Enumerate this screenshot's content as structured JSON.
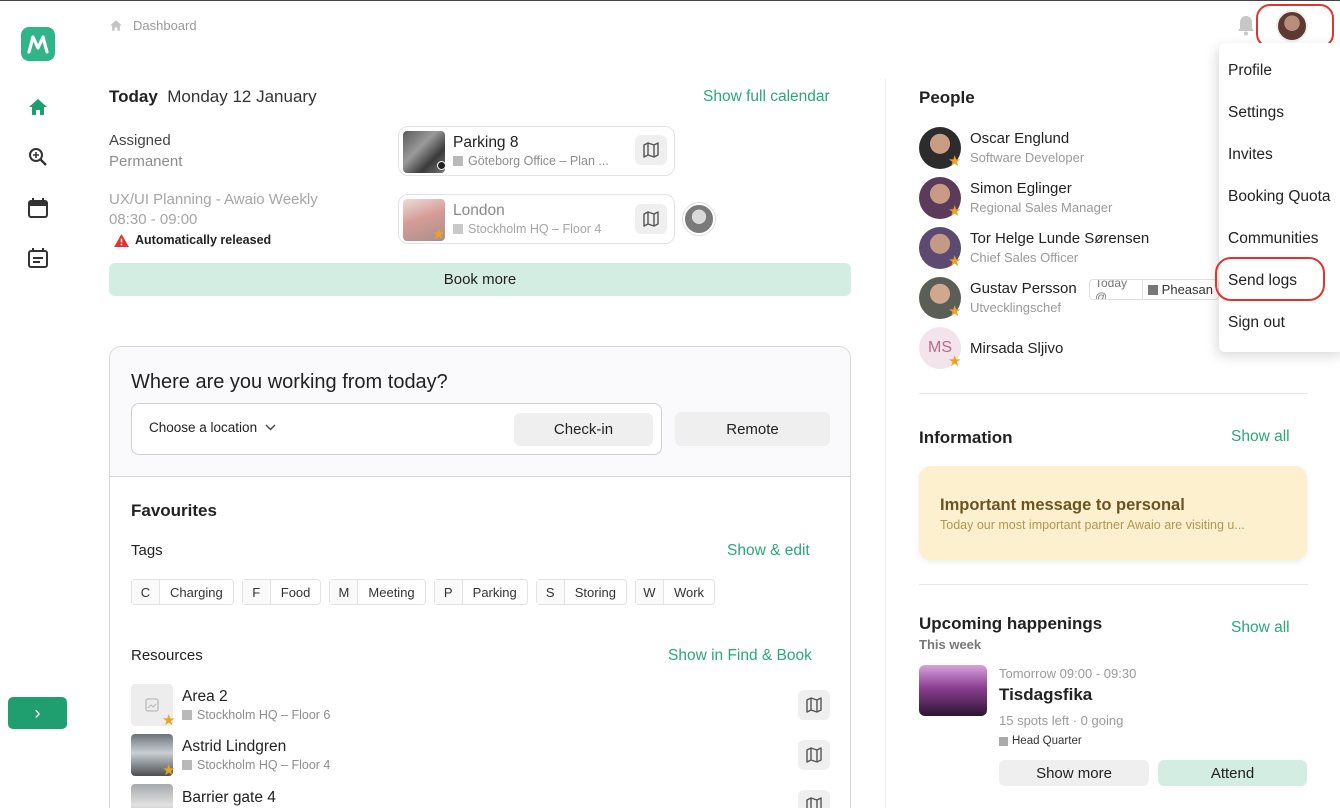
{
  "sidebar": {
    "nav": [
      "home-icon",
      "search-icon",
      "calendar-icon",
      "booking-list-icon"
    ],
    "expand_label": "›"
  },
  "header": {
    "breadcrumb": "Dashboard"
  },
  "today": {
    "label": "Today",
    "date": "Monday 12 January",
    "calendar_link": "Show full calendar",
    "rows": [
      {
        "title": "Assigned",
        "subtitle": "Permanent",
        "card_title": "Parking 8",
        "card_location": "Göteborg Office – Plan ..."
      },
      {
        "title": "UX/UI Planning - Awaio Weekly",
        "subtitle": "08:30 - 09:00",
        "warning": "Automatically released",
        "card_title": "London",
        "card_location": "Stockholm HQ – Floor 4"
      }
    ],
    "book_more": "Book more"
  },
  "working": {
    "question": "Where are you working from today?",
    "location_placeholder": "Choose a location",
    "checkin": "Check-in",
    "remote": "Remote"
  },
  "favourites": {
    "title": "Favourites",
    "tags_label": "Tags",
    "tags_link": "Show & edit",
    "tags": [
      {
        "key": "C",
        "label": "Charging"
      },
      {
        "key": "F",
        "label": "Food"
      },
      {
        "key": "M",
        "label": "Meeting"
      },
      {
        "key": "P",
        "label": "Parking"
      },
      {
        "key": "S",
        "label": "Storing"
      },
      {
        "key": "W",
        "label": "Work"
      }
    ],
    "resources_label": "Resources",
    "resources_link": "Show in Find & Book",
    "resources": [
      {
        "name": "Area 2",
        "location": "Stockholm HQ – Floor 6"
      },
      {
        "name": "Astrid Lindgren",
        "location": "Stockholm HQ – Floor 4"
      },
      {
        "name": "Barrier gate 4",
        "location": ""
      }
    ]
  },
  "people": {
    "title": "People",
    "list": [
      {
        "name": "Oscar Englund",
        "role": "Software Developer"
      },
      {
        "name": "Simon Eglinger",
        "role": "Regional Sales Manager"
      },
      {
        "name": "Tor Helge Lunde Sørensen",
        "role": "Chief Sales Officer"
      },
      {
        "name": "Gustav Persson",
        "role": "Utvecklingschef",
        "badge_when": "Today @",
        "badge_place": "Pheasan"
      },
      {
        "name": "Mirsada Sljivo",
        "role": "",
        "initials": "MS"
      }
    ]
  },
  "information": {
    "title": "Information",
    "link": "Show all",
    "card_title": "Important message to personal",
    "card_text": "Today our most important partner Awaio are visiting u..."
  },
  "upcoming": {
    "title": "Upcoming happenings",
    "subtitle": "This week",
    "link": "Show all",
    "event_time": "Tomorrow 09:00 - 09:30",
    "event_title": "Tisdagsfika",
    "event_spots": "15 spots left · 0 going",
    "event_location": "Head Quarter",
    "show_more": "Show more",
    "attend": "Attend"
  },
  "user_menu": {
    "items": [
      "Profile",
      "Settings",
      "Invites",
      "Booking Quota",
      "Communities",
      "Send logs",
      "Sign out"
    ]
  },
  "colors": {
    "accent": "#2aa878",
    "brand": "#2fb587",
    "highlight_ring": "#e0342e",
    "star": "#f0a11e"
  }
}
